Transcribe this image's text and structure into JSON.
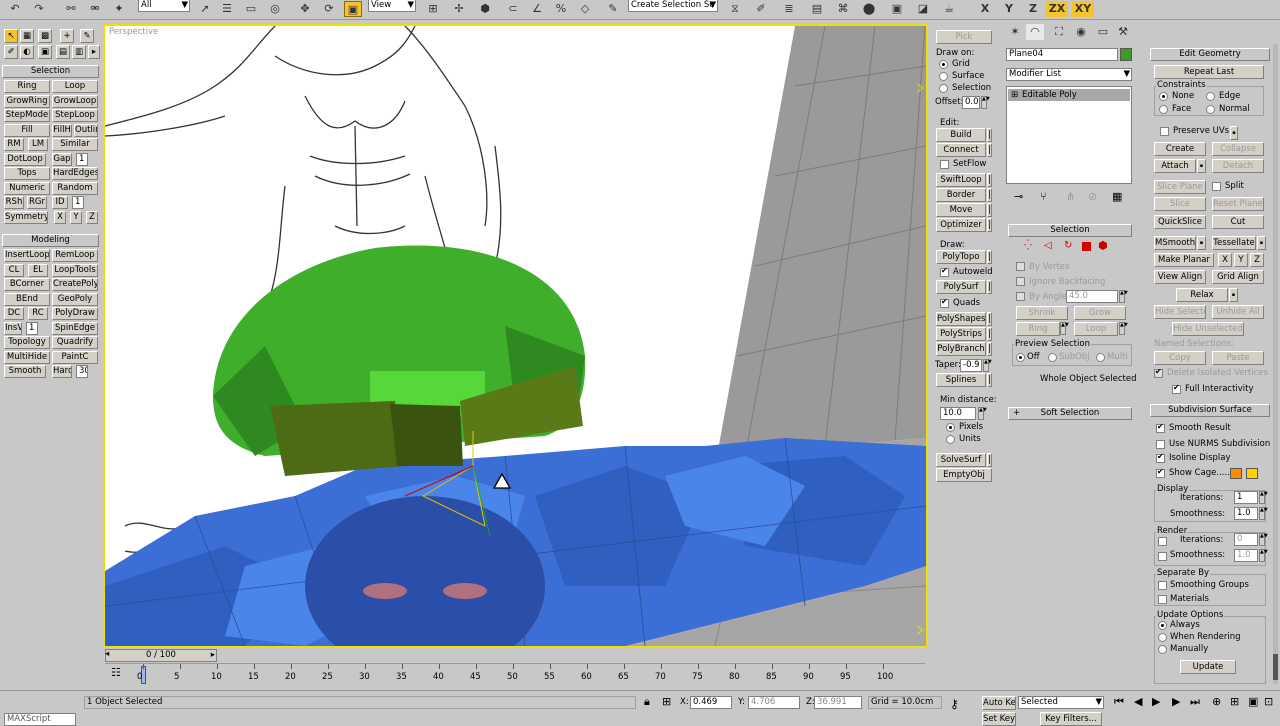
{
  "toolbar": {
    "filter": "All",
    "refcoord": "View",
    "named_sel": "Create Selection Se",
    "axes": [
      "X",
      "Y",
      "Z",
      "ZX",
      "XY"
    ]
  },
  "left": {
    "selection_title": "Selection",
    "sel_rows": [
      [
        "Ring",
        "Loop"
      ],
      [
        "GrowRing",
        "GrowLoop"
      ],
      [
        "StepMode",
        "StepLoop"
      ],
      [
        "Fill",
        "FillH",
        "Outline"
      ],
      [
        "RM",
        "LM",
        "Similar"
      ],
      [
        "DotLoop",
        "Gap",
        "1"
      ],
      [
        "Tops",
        "HardEdges"
      ],
      [
        "Numeric",
        "Random"
      ],
      [
        "RSh",
        "RGr",
        "ID",
        "1"
      ],
      [
        "Symmetry",
        "X",
        "Y",
        "Z"
      ]
    ],
    "modeling_title": "Modeling",
    "mod_rows": [
      [
        "InsertLoop",
        "RemLoop"
      ],
      [
        "CL",
        "EL",
        "LoopTools"
      ],
      [
        "BCorner",
        "CreatePoly"
      ],
      [
        "BEnd",
        "GeoPoly"
      ],
      [
        "DC",
        "RC",
        "PolyDraw"
      ],
      [
        "InsV",
        "1",
        "SpinEdge"
      ],
      [
        "Topology",
        "Quadrify"
      ],
      [
        "MultiHide",
        "PaintC"
      ],
      [
        "Smooth",
        "Hard",
        "30"
      ]
    ]
  },
  "viewport": {
    "label": "Perspective"
  },
  "timeline": {
    "frame": "0 / 100",
    "ticks": [
      "0",
      "5",
      "10",
      "15",
      "20",
      "25",
      "30",
      "35",
      "40",
      "45",
      "50",
      "55",
      "60",
      "65",
      "70",
      "75",
      "80",
      "85",
      "90",
      "95",
      "100"
    ]
  },
  "status": {
    "maxscript": "MAXScript",
    "objects": "1 Object Selected",
    "x": "0.469",
    "y": "4.706",
    "z": "36.991",
    "grid": "Grid = 10.0cm",
    "autokey": "Auto Key",
    "setkey": "Set Key",
    "selected": "Selected",
    "keyfilters": "Key Filters..."
  },
  "graphite": {
    "pick": "Pick",
    "draw_on": "Draw on:",
    "grid": "Grid",
    "surface": "Surface",
    "selection": "Selection",
    "offset": "Offset:",
    "offset_val": "0.0",
    "edit": "Edit:",
    "edit_btns": [
      "Build",
      "Connect",
      "SetFlow",
      "SwiftLoop",
      "Border",
      "Move",
      "Optimizer"
    ],
    "draw": "Draw:",
    "polytopo": "PolyTopo",
    "autoweld": "Autoweld",
    "polysurf": "PolySurf",
    "quads": "Quads",
    "draw_btns": [
      "PolyShapes",
      "PolyStrips",
      "PolyBranch"
    ],
    "taper": "Taper:",
    "taper_val": "-0.9",
    "splines": "Splines",
    "mindist": "Min distance:",
    "mindist_val": "10.0",
    "pixels": "Pixels",
    "units": "Units",
    "solvesurf": "SolveSurf",
    "emptyobj": "EmptyObj"
  },
  "modify": {
    "name": "Plane04",
    "color": "#3f9a2a",
    "modlist": "Modifier List",
    "stack_item": "Editable Poly",
    "selection_title": "Selection",
    "by_vertex": "By Vertex",
    "ignore_bf": "Ignore Backfacing",
    "by_angle": "By Angle:",
    "angle": "45.0",
    "shrink": "Shrink",
    "grow": "Grow",
    "ring": "Ring",
    "loop": "Loop",
    "preview": "Preview Selection",
    "off": "Off",
    "subobj": "SubObj",
    "multi": "Multi",
    "whole": "Whole Object Selected",
    "soft": "Soft Selection"
  },
  "editgeo": {
    "title": "Edit Geometry",
    "repeat": "Repeat Last",
    "constraints": "Constraints",
    "none": "None",
    "edge": "Edge",
    "face": "Face",
    "normal": "Normal",
    "preserve": "Preserve UVs",
    "create": "Create",
    "collapse": "Collapse",
    "attach": "Attach",
    "detach": "Detach",
    "sliceplane": "Slice Plane",
    "split": "Split",
    "slice": "Slice",
    "resetplane": "Reset Plane",
    "quickslice": "QuickSlice",
    "cut": "Cut",
    "msmooth": "MSmooth",
    "tessellate": "Tessellate",
    "makeplanar": "Make Planar",
    "x": "X",
    "y": "Y",
    "z": "Z",
    "viewalign": "View Align",
    "gridalign": "Grid Align",
    "relax": "Relax",
    "hidesel": "Hide Selected",
    "unhideall": "Unhide All",
    "hideunsel": "Hide Unselected",
    "namedsel": "Named Selections:",
    "copy": "Copy",
    "paste": "Paste",
    "delisolated": "Delete Isolated Vertices",
    "fullinter": "Full Interactivity"
  },
  "subdiv": {
    "title": "Subdivision Surface",
    "smooth": "Smooth Result",
    "nurms": "Use NURMS Subdivision",
    "isoline": "Isoline Display",
    "cage": "Show Cage......",
    "display": "Display",
    "iterations": "Iterations:",
    "it_val": "1",
    "smoothness": "Smoothness:",
    "sm_val": "1.0",
    "render": "Render",
    "r_it": "0",
    "r_sm": "1.0",
    "sepby": "Separate By",
    "smgroups": "Smoothing Groups",
    "materials": "Materials",
    "update_opts": "Update Options",
    "always": "Always",
    "whenrender": "When Rendering",
    "manually": "Manually",
    "update": "Update",
    "cage1": "#ff8c00",
    "cage2": "#ffd200"
  }
}
